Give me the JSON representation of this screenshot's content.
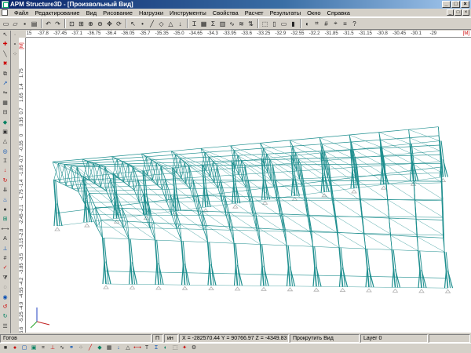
{
  "window": {
    "title": "APM Structure3D - [Произвольный Вид]",
    "controls": [
      "_",
      "□",
      "×"
    ]
  },
  "menu": {
    "items": [
      "Файл",
      "Редактирование",
      "Вид",
      "Рисование",
      "Нагрузки",
      "Инструменты",
      "Свойства",
      "Расчет",
      "Результаты",
      "Окно",
      "Справка"
    ],
    "mdi_controls": [
      "_",
      "□",
      "×"
    ]
  },
  "toolbar": {
    "icons": [
      "new-icon",
      "open-icon",
      "save-icon",
      "print-icon",
      "undo-icon",
      "redo-icon",
      "zoom-fit-icon",
      "zoom-window-icon",
      "zoom-in-icon",
      "zoom-out-icon",
      "pan-icon",
      "rotate-icon",
      "select-icon",
      "node-icon",
      "rod-icon",
      "plate-icon",
      "support-icon",
      "load-icon",
      "section-icon",
      "material-icon",
      "calc-icon",
      "results-icon",
      "deform-icon",
      "stress-icon",
      "force-icon",
      "view-3d-icon",
      "view-front-icon",
      "view-top-icon",
      "view-side-icon",
      "shade-icon",
      "wire-icon",
      "grid-icon",
      "snap-icon",
      "layers-icon",
      "help-icon"
    ]
  },
  "ruler_top": {
    "start": "15",
    "labels": [
      "-37.8",
      "-37.45",
      "-37.1",
      "-36.75",
      "-36.4",
      "-36.05",
      "-35.7",
      "-35.35",
      "-35.0",
      "-34.65",
      "-34.3",
      "-33.95",
      "-33.6",
      "-33.25",
      "-32.9",
      "-32.55",
      "-32.2",
      "-31.85",
      "-31.5",
      "-31.15",
      "-30.8",
      "-30.45",
      "-30.1",
      "-29"
    ],
    "unit": "[M]"
  },
  "ruler_left": {
    "unit": "[M]",
    "labels": [
      "1.75",
      "1.4",
      "1.05",
      "0.7",
      "0.35",
      "0",
      "-0.35",
      "-0.7",
      "-1.05",
      "-1.4",
      "-1.75",
      "-2.1",
      "-2.45",
      "-2.8",
      "-3.15",
      "-3.5",
      "-3.85",
      "-4.2",
      "-4.55",
      "-4.9",
      "-5.25",
      "-5.6",
      "-5.95"
    ]
  },
  "status": {
    "ready": "Готов",
    "p_label": "П",
    "mode": "ин",
    "coords": "X = -282570.44 Y = 90766.97 Z = -4349.83",
    "hint": "Прокрутить Вид",
    "layer": "Layer 0"
  },
  "colors": {
    "structure": "#1f8f8f",
    "support": "#b0b0b0",
    "titlebar_start": "#0a246a",
    "titlebar_end": "#a6caf0"
  }
}
